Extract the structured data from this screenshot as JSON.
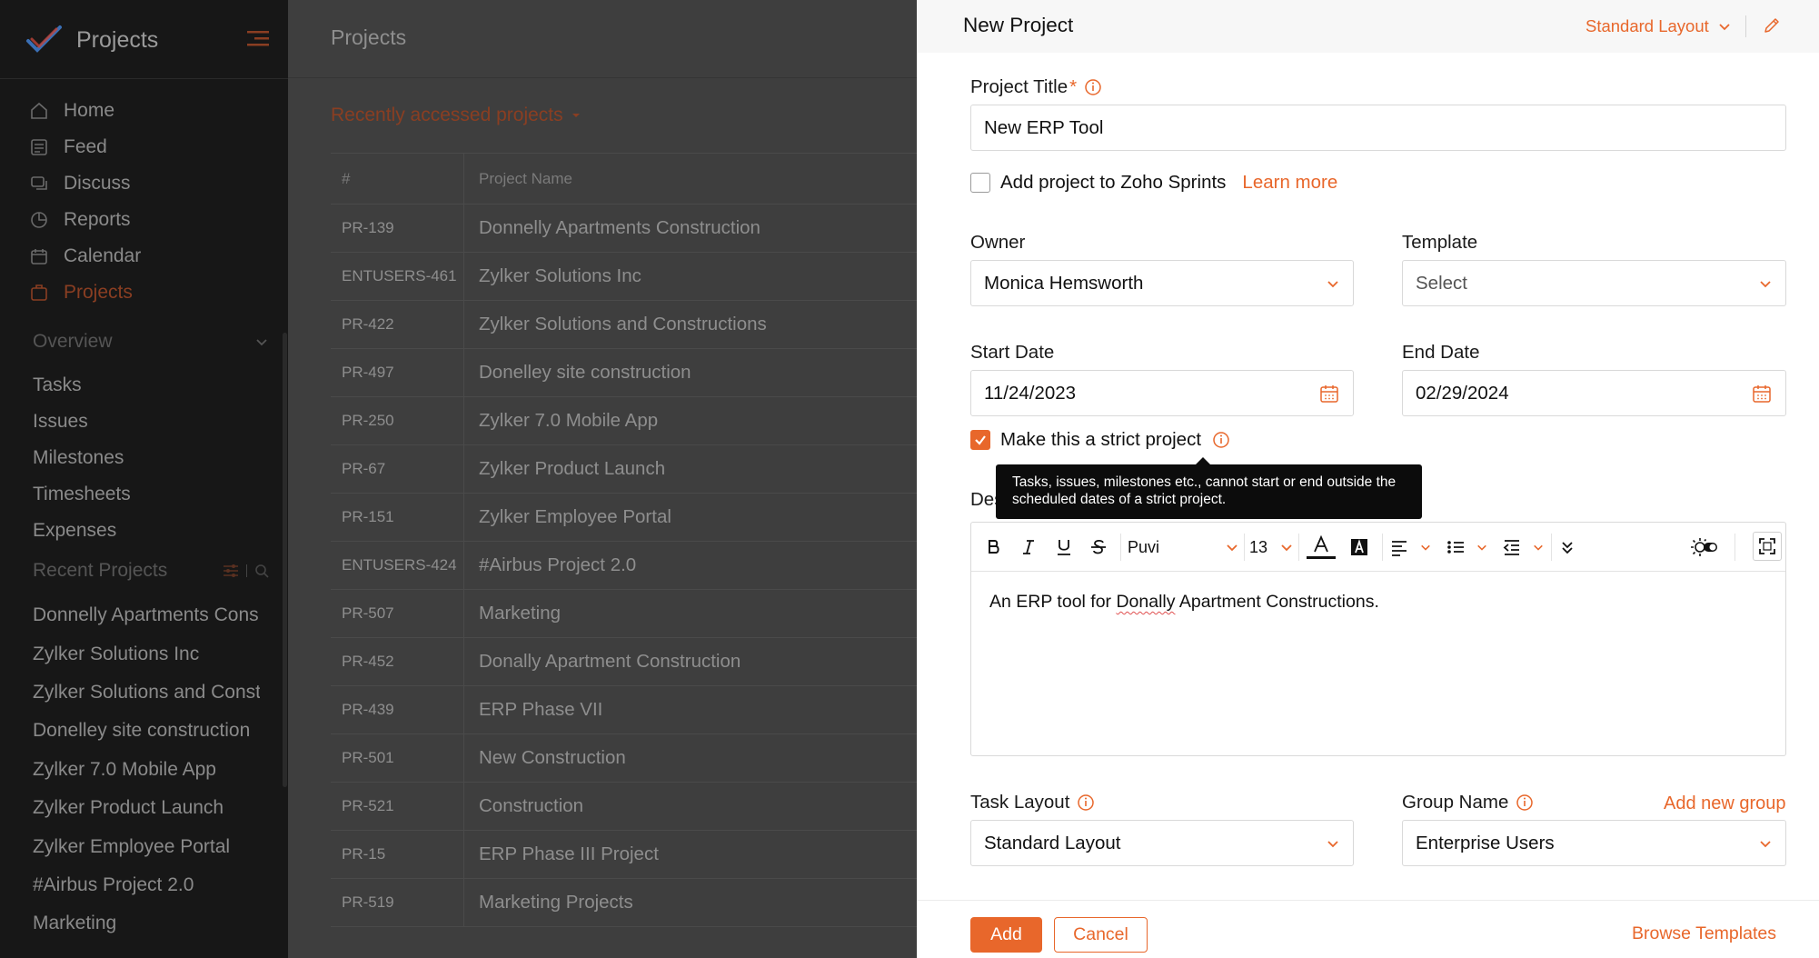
{
  "colors": {
    "accent": "#e8672b",
    "sidebar_bg": "#171717",
    "overlay_bg": "#3e3e3e"
  },
  "sidebar": {
    "app_title": "Projects",
    "nav_items": [
      {
        "label": "Home",
        "icon": "home-icon"
      },
      {
        "label": "Feed",
        "icon": "feed-icon"
      },
      {
        "label": "Discuss",
        "icon": "discuss-icon"
      },
      {
        "label": "Reports",
        "icon": "reports-icon"
      },
      {
        "label": "Calendar",
        "icon": "calendar-icon"
      },
      {
        "label": "Projects",
        "icon": "projects-icon",
        "active": true
      }
    ],
    "section_title": "Overview",
    "sub_items": [
      "Tasks",
      "Issues",
      "Milestones",
      "Timesheets",
      "Expenses"
    ],
    "recent_title": "Recent Projects",
    "recent_projects": [
      "Donnelly Apartments Cons",
      "Zylker Solutions Inc",
      "Zylker Solutions and Const",
      "Donelley site construction",
      "Zylker 7.0 Mobile App",
      "Zylker Product Launch",
      "Zylker Employee Portal",
      "#Airbus Project 2.0",
      "Marketing"
    ]
  },
  "main": {
    "title": "Projects",
    "recent_dropdown": "Recently accessed projects",
    "table": {
      "headers": [
        "#",
        "Project Name"
      ],
      "rows": [
        [
          "PR-139",
          "Donnelly Apartments Construction"
        ],
        [
          "ENTUSERS-461",
          "Zylker Solutions Inc"
        ],
        [
          "PR-422",
          "Zylker Solutions and Constructions"
        ],
        [
          "PR-497",
          "Donelley site construction"
        ],
        [
          "PR-250",
          "Zylker 7.0 Mobile App"
        ],
        [
          "PR-67",
          "Zylker Product Launch"
        ],
        [
          "PR-151",
          "Zylker Employee Portal"
        ],
        [
          "ENTUSERS-424",
          "#Airbus Project 2.0"
        ],
        [
          "PR-507",
          "Marketing"
        ],
        [
          "PR-452",
          "Donally Apartment Construction"
        ],
        [
          "PR-439",
          "ERP Phase VII"
        ],
        [
          "PR-501",
          "New Construction"
        ],
        [
          "PR-521",
          "Construction"
        ],
        [
          "PR-15",
          "ERP Phase III Project"
        ],
        [
          "PR-519",
          "Marketing Projects"
        ]
      ]
    }
  },
  "panel": {
    "title": "New Project",
    "layout_dropdown": "Standard Layout",
    "project_title_label": "Project Title",
    "required_mark": "*",
    "project_title_value": "New ERP Tool",
    "sprints_label": "Add project to Zoho Sprints",
    "learn_more": "Learn more",
    "owner_label": "Owner",
    "owner_value": "Monica Hemsworth",
    "template_label": "Template",
    "template_value": "Select",
    "start_date_label": "Start Date",
    "start_date_value": "11/24/2023",
    "end_date_label": "End Date",
    "end_date_value": "02/29/2024",
    "strict_label": "Make this a strict project",
    "strict_checked": true,
    "tooltip_text": "Tasks, issues, milestones etc., cannot start or end outside the scheduled dates of a strict project.",
    "description_label_visible": "Des",
    "editor": {
      "font": "Puvi",
      "size": "13",
      "content_before": "An ERP tool for ",
      "content_misspelled": "Donally",
      "content_after": " Apartment Constructions."
    },
    "task_layout_label": "Task Layout",
    "task_layout_value": "Standard Layout",
    "group_name_label": "Group Name",
    "group_name_value": "Enterprise Users",
    "add_new_group": "Add new group",
    "add_button": "Add",
    "cancel_button": "Cancel",
    "browse_templates": "Browse Templates"
  }
}
